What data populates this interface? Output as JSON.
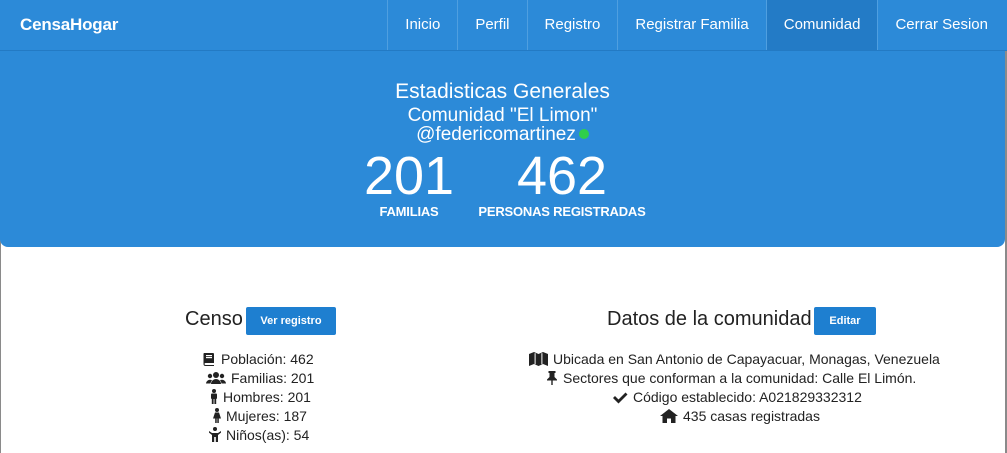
{
  "navbar": {
    "brand": "CensaHogar",
    "items": [
      {
        "label": "Inicio"
      },
      {
        "label": "Perfil"
      },
      {
        "label": "Registro"
      },
      {
        "label": "Registrar Familia"
      },
      {
        "label": "Comunidad",
        "active": true
      },
      {
        "label": "Cerrar Sesion"
      }
    ]
  },
  "hero": {
    "title": "Estadisticas Generales",
    "community": "Comunidad \"El Limon\"",
    "user": "@federicomartinez",
    "stats": [
      {
        "value": "201",
        "label": "FAMILIAS"
      },
      {
        "value": "462",
        "label": "PERSONAS REGISTRADAS"
      }
    ]
  },
  "censo": {
    "title": "Censo",
    "button": "Ver registro",
    "items": [
      {
        "icon": "book-icon",
        "text": "Población: 462"
      },
      {
        "icon": "users-icon",
        "text": "Familias: 201"
      },
      {
        "icon": "male-icon",
        "text": "Hombres: 201"
      },
      {
        "icon": "female-icon",
        "text": "Mujeres: 187"
      },
      {
        "icon": "child-icon",
        "text": "Niños(as): 54"
      }
    ]
  },
  "comunidad": {
    "title": "Datos de la comunidad",
    "button": "Editar",
    "items": [
      {
        "icon": "map-icon",
        "text": "Ubicada en San Antonio de Capayacuar, Monagas, Venezuela"
      },
      {
        "icon": "pin-icon",
        "text": "Sectores que conforman a la comunidad: Calle El Limón."
      },
      {
        "icon": "check-icon",
        "text": "Código establecido: A021829332312"
      },
      {
        "icon": "home-icon",
        "text": "435 casas registradas"
      }
    ]
  },
  "colors": {
    "primary": "#2c8ad8",
    "button": "#1e7fd0",
    "online": "#2fcf4a"
  }
}
